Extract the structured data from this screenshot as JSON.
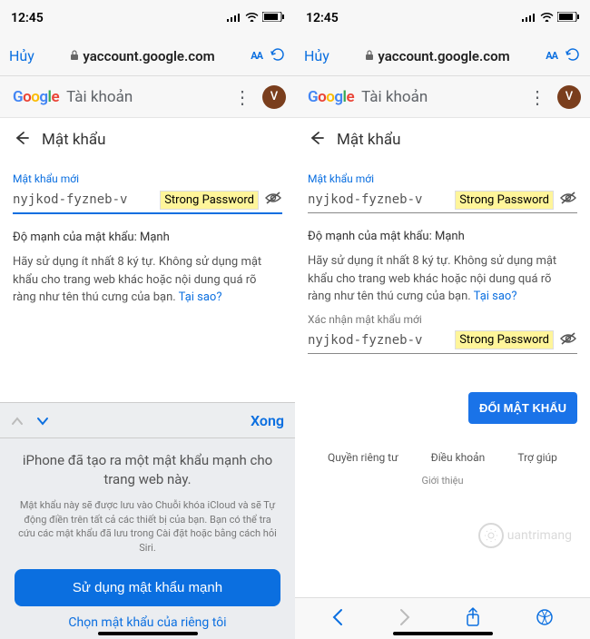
{
  "status": {
    "time": "12:45"
  },
  "safari": {
    "cancel": "Hủy",
    "url": "yaccount.google.com",
    "aa": "AA",
    "done": "Xong"
  },
  "google": {
    "logo_letters": [
      "G",
      "o",
      "o",
      "g",
      "l",
      "e"
    ],
    "account_label": "Tài khoản",
    "avatar_initial": "V"
  },
  "page": {
    "title": "Mật khẩu",
    "new_pwd_label": "Mật khẩu mới",
    "confirm_pwd_label": "Xác nhận mật khẩu mới",
    "pwd_value": "nyjkod-fyzneb-v",
    "strong_badge": "Strong Password",
    "strength_line": "Độ mạnh của mật khẩu: Mạnh",
    "hint": "Hãy sử dụng ít nhất 8 ký tự. Không sử dụng mật khẩu cho trang web khác hoặc nội dung quá rõ ràng như tên thú cưng của bạn. ",
    "why": "Tại sao?",
    "change_btn": "ĐỔI MẬT KHẨU",
    "footer": {
      "privacy": "Quyền riêng tư",
      "terms": "Điều khoản",
      "help": "Trợ giúp",
      "about": "Giới thiệu"
    }
  },
  "suggest": {
    "title": "iPhone đã tạo ra một mật khẩu mạnh cho trang web này.",
    "sub": "Mật khẩu này sẽ được lưu vào Chuỗi khóa iCloud và sẽ Tự động điền trên tất cả các thiết bị của bạn. Bạn có thể tra cứu các mật khẩu đã lưu trong Cài đặt hoặc bằng cách hỏi Siri.",
    "use_btn": "Sử dụng mật khẩu mạnh",
    "own_link": "Chọn mật khẩu của riêng tôi"
  },
  "watermark": "uantrimang"
}
